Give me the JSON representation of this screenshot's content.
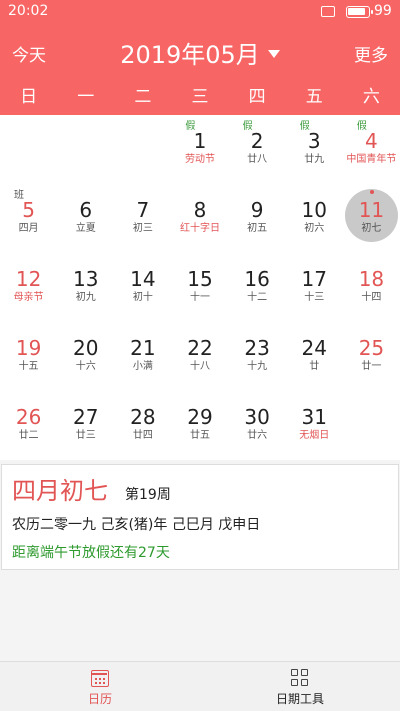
{
  "status": {
    "time": "20:02",
    "battery": "99"
  },
  "header": {
    "today_label": "今天",
    "title": "2019年05月",
    "more_label": "更多"
  },
  "weekdays": [
    "日",
    "一",
    "二",
    "三",
    "四",
    "五",
    "六"
  ],
  "calendar": {
    "weeks": [
      [
        null,
        null,
        null,
        {
          "num": "1",
          "lunar": "劳动节",
          "mark": "假",
          "weekend": false,
          "fest": true
        },
        {
          "num": "2",
          "lunar": "廿八",
          "mark": "假",
          "weekend": false,
          "fest": false
        },
        {
          "num": "3",
          "lunar": "廿九",
          "mark": "假",
          "weekend": false,
          "fest": false
        },
        {
          "num": "4",
          "lunar": "中国青年节",
          "mark": "假",
          "weekend": true,
          "fest": true
        }
      ],
      [
        {
          "num": "5",
          "lunar": "四月",
          "mark": "班",
          "weekend": true,
          "fest": false
        },
        {
          "num": "6",
          "lunar": "立夏",
          "mark": "",
          "weekend": false,
          "fest": false
        },
        {
          "num": "7",
          "lunar": "初三",
          "mark": "",
          "weekend": false,
          "fest": false
        },
        {
          "num": "8",
          "lunar": "红十字日",
          "mark": "",
          "weekend": false,
          "fest": true
        },
        {
          "num": "9",
          "lunar": "初五",
          "mark": "",
          "weekend": false,
          "fest": false
        },
        {
          "num": "10",
          "lunar": "初六",
          "mark": "",
          "weekend": false,
          "fest": false
        },
        {
          "num": "11",
          "lunar": "初七",
          "mark": "",
          "weekend": true,
          "fest": false,
          "selected": true
        }
      ],
      [
        {
          "num": "12",
          "lunar": "母亲节",
          "mark": "",
          "weekend": true,
          "fest": true
        },
        {
          "num": "13",
          "lunar": "初九",
          "mark": "",
          "weekend": false,
          "fest": false
        },
        {
          "num": "14",
          "lunar": "初十",
          "mark": "",
          "weekend": false,
          "fest": false
        },
        {
          "num": "15",
          "lunar": "十一",
          "mark": "",
          "weekend": false,
          "fest": false
        },
        {
          "num": "16",
          "lunar": "十二",
          "mark": "",
          "weekend": false,
          "fest": false
        },
        {
          "num": "17",
          "lunar": "十三",
          "mark": "",
          "weekend": false,
          "fest": false
        },
        {
          "num": "18",
          "lunar": "十四",
          "mark": "",
          "weekend": true,
          "fest": false
        }
      ],
      [
        {
          "num": "19",
          "lunar": "十五",
          "mark": "",
          "weekend": true,
          "fest": false
        },
        {
          "num": "20",
          "lunar": "十六",
          "mark": "",
          "weekend": false,
          "fest": false
        },
        {
          "num": "21",
          "lunar": "小满",
          "mark": "",
          "weekend": false,
          "fest": false
        },
        {
          "num": "22",
          "lunar": "十八",
          "mark": "",
          "weekend": false,
          "fest": false
        },
        {
          "num": "23",
          "lunar": "十九",
          "mark": "",
          "weekend": false,
          "fest": false
        },
        {
          "num": "24",
          "lunar": "廿",
          "mark": "",
          "weekend": false,
          "fest": false
        },
        {
          "num": "25",
          "lunar": "廿一",
          "mark": "",
          "weekend": true,
          "fest": false
        }
      ],
      [
        {
          "num": "26",
          "lunar": "廿二",
          "mark": "",
          "weekend": true,
          "fest": false
        },
        {
          "num": "27",
          "lunar": "廿三",
          "mark": "",
          "weekend": false,
          "fest": false
        },
        {
          "num": "28",
          "lunar": "廿四",
          "mark": "",
          "weekend": false,
          "fest": false
        },
        {
          "num": "29",
          "lunar": "廿五",
          "mark": "",
          "weekend": false,
          "fest": false
        },
        {
          "num": "30",
          "lunar": "廿六",
          "mark": "",
          "weekend": false,
          "fest": false
        },
        {
          "num": "31",
          "lunar": "无烟日",
          "mark": "",
          "weekend": false,
          "fest": true
        },
        null
      ]
    ]
  },
  "info": {
    "lunar_date": "四月初七",
    "week_no": "第19周",
    "ganzhi": "农历二零一九 己亥(猪)年 己巳月 戊申日",
    "countdown": "距离端午节放假还有27天"
  },
  "tabs": [
    {
      "label": "日历",
      "icon": "calendar-icon",
      "active": true
    },
    {
      "label": "日期工具",
      "icon": "grid-icon",
      "active": false
    }
  ],
  "colors": {
    "accent": "#f76565",
    "festival": "#e25555",
    "holiday_mark": "#3c9a3c"
  }
}
